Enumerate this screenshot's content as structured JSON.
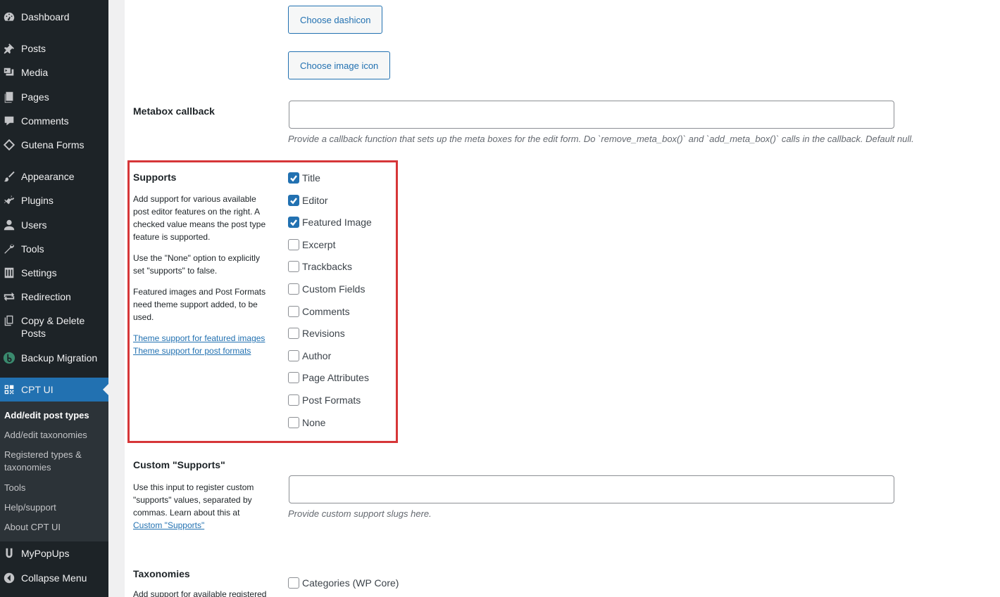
{
  "sidebar": {
    "items": [
      {
        "label": "Dashboard",
        "icon": "dashboard-icon"
      },
      {
        "label": "Posts",
        "icon": "pushpin-icon"
      },
      {
        "label": "Media",
        "icon": "media-icon"
      },
      {
        "label": "Pages",
        "icon": "pages-icon"
      },
      {
        "label": "Comments",
        "icon": "comment-icon"
      },
      {
        "label": "Gutena Forms",
        "icon": "diamond-icon"
      },
      {
        "label": "Appearance",
        "icon": "paintbrush-icon"
      },
      {
        "label": "Plugins",
        "icon": "plugin-icon"
      },
      {
        "label": "Users",
        "icon": "user-icon"
      },
      {
        "label": "Tools",
        "icon": "wrench-icon"
      },
      {
        "label": "Settings",
        "icon": "sliders-icon"
      },
      {
        "label": "Redirection",
        "icon": "redirect-arrows-icon"
      },
      {
        "label": "Copy & Delete Posts",
        "icon": "copy-icon"
      },
      {
        "label": "Backup Migration",
        "icon": "backup-logo-icon"
      },
      {
        "label": "CPT UI",
        "icon": "grid-icon"
      },
      {
        "label": "MyPopUps",
        "icon": "mypopups-logo-icon"
      },
      {
        "label": "Collapse Menu",
        "icon": "collapse-arrow-icon"
      }
    ],
    "submenu": [
      "Add/edit post types",
      "Add/edit taxonomies",
      "Registered types & taxonomies",
      "Tools",
      "Help/support",
      "About CPT UI"
    ]
  },
  "icon_buttons": {
    "dashicon": "Choose dashicon",
    "image_icon": "Choose image icon"
  },
  "metabox": {
    "label": "Metabox callback",
    "value": "",
    "help": "Provide a callback function that sets up the meta boxes for the edit form. Do `remove_meta_box()` and `add_meta_box()` calls in the callback. Default null."
  },
  "supports": {
    "label": "Supports",
    "desc1": "Add support for various available post editor features on the right. A checked value means the post type feature is supported.",
    "desc2": "Use the \"None\" option to explicitly set \"supports\" to false.",
    "desc3": "Featured images and Post Formats need theme support added, to be used.",
    "link1": "Theme support for featured images",
    "link2": "Theme support for post formats",
    "options": [
      {
        "label": "Title",
        "checked": true
      },
      {
        "label": "Editor",
        "checked": true
      },
      {
        "label": "Featured Image",
        "checked": true
      },
      {
        "label": "Excerpt",
        "checked": false
      },
      {
        "label": "Trackbacks",
        "checked": false
      },
      {
        "label": "Custom Fields",
        "checked": false
      },
      {
        "label": "Comments",
        "checked": false
      },
      {
        "label": "Revisions",
        "checked": false
      },
      {
        "label": "Author",
        "checked": false
      },
      {
        "label": "Page Attributes",
        "checked": false
      },
      {
        "label": "Post Formats",
        "checked": false
      },
      {
        "label": "None",
        "checked": false
      }
    ],
    "highlight_color": "#d63638"
  },
  "custom_supports": {
    "label": "Custom \"Supports\"",
    "desc": "Use this input to register custom \"supports\" values, separated by commas. Learn about this at ",
    "link": "Custom \"Supports\"",
    "value": "",
    "help": "Provide custom support slugs here."
  },
  "taxonomies": {
    "label": "Taxonomies",
    "desc": "Add support for available registered",
    "options": [
      {
        "label": "Categories (WP Core)",
        "checked": false
      }
    ]
  },
  "colors": {
    "accent": "#2271b1",
    "sidebar_bg": "#1d2327",
    "submenu_bg": "#2c3338"
  }
}
